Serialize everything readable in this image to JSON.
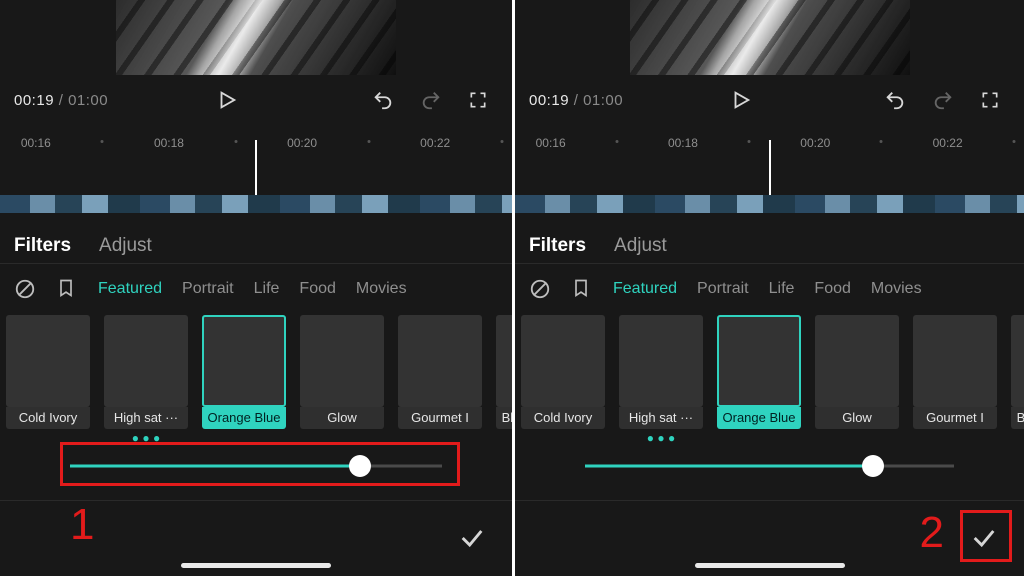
{
  "player": {
    "current": "00:19",
    "sep": " / ",
    "duration": "01:00"
  },
  "ruler": {
    "t0": "00:16",
    "t1": "00:18",
    "t2": "00:20",
    "t3": "00:22"
  },
  "tabs": {
    "filters": "Filters",
    "adjust": "Adjust"
  },
  "cats": {
    "c0": "Featured",
    "c1": "Portrait",
    "c2": "Life",
    "c3": "Food",
    "c4": "Movies"
  },
  "tiles": {
    "t0": "Cold Ivory",
    "t1": "High sat ···",
    "t2": "Orange Blue",
    "t3": "Glow",
    "t4": "Gourmet I",
    "t5": "Bla"
  },
  "slider": {
    "pct": 78
  },
  "annotations": {
    "step1": "1",
    "step2": "2"
  }
}
